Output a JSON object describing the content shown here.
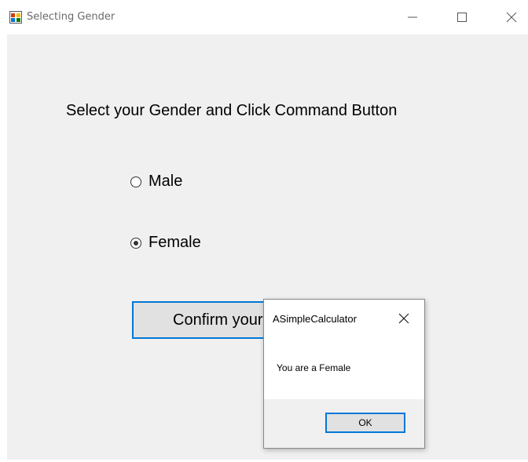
{
  "window": {
    "title": "Selecting Gender",
    "controls": {
      "minimize": "minimize-icon",
      "maximize": "maximize-icon",
      "close": "close-icon"
    }
  },
  "form": {
    "instruction": "Select your Gender and Click Command Button",
    "options": [
      {
        "label": "Male",
        "checked": false
      },
      {
        "label": "Female",
        "checked": true
      }
    ],
    "confirm_label": "Confirm your Gender"
  },
  "dialog": {
    "title": "ASimpleCalculator",
    "message": "You are a Female",
    "ok_label": "OK"
  },
  "colors": {
    "accent": "#0078d7",
    "client_bg": "#f0f0f0",
    "button_bg": "#e1e1e1"
  }
}
